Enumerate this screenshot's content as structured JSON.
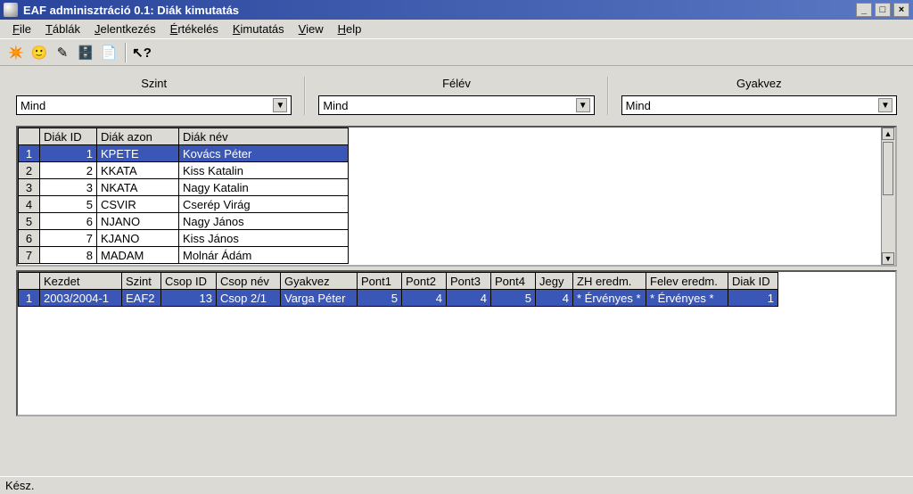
{
  "window": {
    "title": "EAF adminisztráció 0.1: Diák kimutatás"
  },
  "menus": {
    "file": {
      "label": "File",
      "accel": "F"
    },
    "tablak": {
      "label": "Táblák",
      "accel": "T"
    },
    "jelentk": {
      "label": "Jelentkezés",
      "accel": "J"
    },
    "ertekeles": {
      "label": "Értékelés",
      "accel": "É"
    },
    "kimutatas": {
      "label": "Kimutatás",
      "accel": "K"
    },
    "view": {
      "label": "View",
      "accel": "V"
    },
    "help": {
      "label": "Help",
      "accel": "H"
    }
  },
  "filters": {
    "szint": {
      "label": "Szint",
      "value": "Mind"
    },
    "felev": {
      "label": "Félév",
      "value": "Mind"
    },
    "gyakvez": {
      "label": "Gyakvez",
      "value": "Mind"
    }
  },
  "students": {
    "headers": {
      "id": "Diák ID",
      "azon": "Diák azon",
      "nev": "Diák név"
    },
    "rows": [
      {
        "n": "1",
        "id": "1",
        "azon": "KPETE",
        "nev": "Kovács Péter",
        "selected": true
      },
      {
        "n": "2",
        "id": "2",
        "azon": "KKATA",
        "nev": "Kiss Katalin"
      },
      {
        "n": "3",
        "id": "3",
        "azon": "NKATA",
        "nev": "Nagy Katalin"
      },
      {
        "n": "4",
        "id": "5",
        "azon": "CSVIR",
        "nev": "Cserép Virág"
      },
      {
        "n": "5",
        "id": "6",
        "azon": "NJANO",
        "nev": "Nagy János"
      },
      {
        "n": "6",
        "id": "7",
        "azon": "KJANO",
        "nev": "Kiss János"
      },
      {
        "n": "7",
        "id": "8",
        "azon": "MADAM",
        "nev": "Molnár Ádám"
      }
    ]
  },
  "detail": {
    "headers": {
      "kezdet": "Kezdet",
      "szint": "Szint",
      "csopid": "Csop ID",
      "csopnev": "Csop név",
      "gyakvez": "Gyakvez",
      "pont1": "Pont1",
      "pont2": "Pont2",
      "pont3": "Pont3",
      "pont4": "Pont4",
      "jegy": "Jegy",
      "zh": "ZH eredm.",
      "felev": "Felev eredm.",
      "diakid": "Diak ID"
    },
    "rows": [
      {
        "n": "1",
        "kezdet": "2003/2004-1",
        "szint": "EAF2",
        "csopid": "13",
        "csopnev": "Csop 2/1",
        "gyakvez": "Varga Péter",
        "pont1": "5",
        "pont2": "4",
        "pont3": "4",
        "pont4": "5",
        "jegy": "4",
        "zh": "* Érvényes *",
        "felev": "* Érvényes *",
        "diakid": "1",
        "selected": true
      }
    ]
  },
  "status": "Kész."
}
